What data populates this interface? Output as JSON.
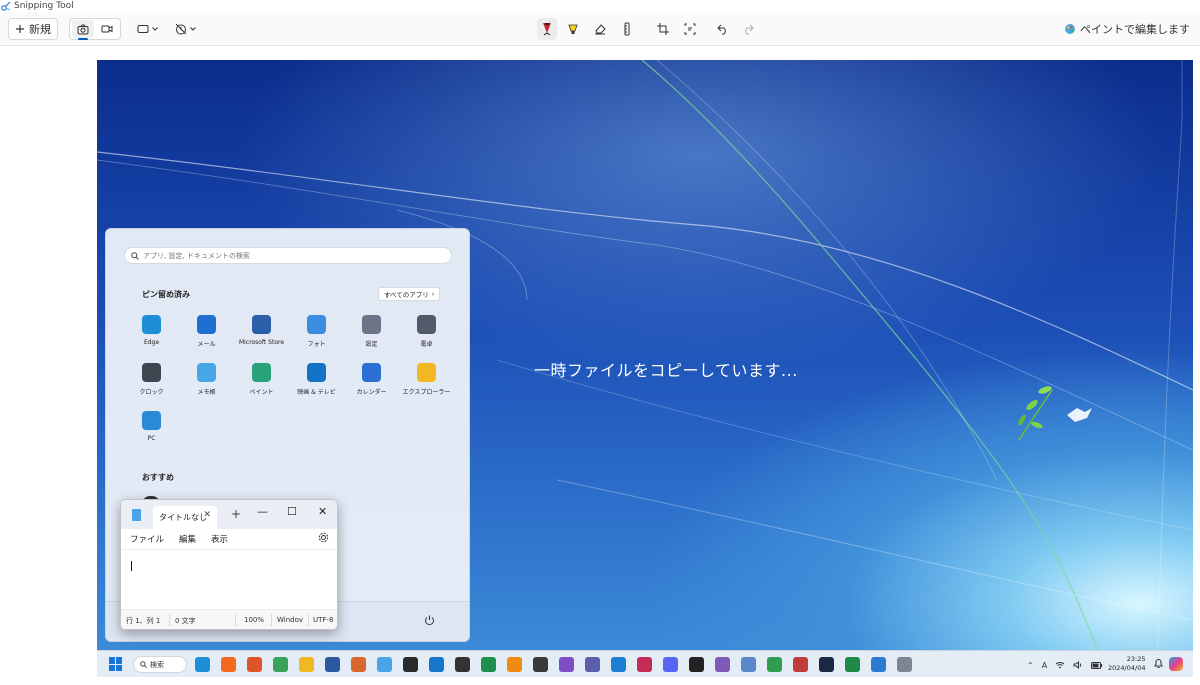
{
  "window": {
    "title": "Snipping Tool"
  },
  "toolbar": {
    "new_label": "新規",
    "paint_label": "ペイントで編集します"
  },
  "capture": {
    "message": "一時ファイルをコピーしています..."
  },
  "start_menu": {
    "search_placeholder": "アプリ, 設定, ドキュメントの検索",
    "pinned_title": "ピン留め済み",
    "all_apps_label": "すべてのアプリ",
    "apps": [
      {
        "label": "Edge",
        "icon": "edge-icon",
        "color": "#1d8fd6"
      },
      {
        "label": "メール",
        "icon": "mail-icon",
        "color": "#1f6fd0"
      },
      {
        "label": "Microsoft Store",
        "icon": "store-icon",
        "color": "#2b5fa8"
      },
      {
        "label": "フォト",
        "icon": "photos-icon",
        "color": "#3b8de0"
      },
      {
        "label": "設定",
        "icon": "settings-icon",
        "color": "#6b7587"
      },
      {
        "label": "電卓",
        "icon": "calculator-icon",
        "color": "#505a68"
      },
      {
        "label": "クロック",
        "icon": "clock-icon",
        "color": "#3f4650"
      },
      {
        "label": "メモ帳",
        "icon": "notepad-icon",
        "color": "#48a5e8"
      },
      {
        "label": "ペイント",
        "icon": "paint-icon",
        "color": "#2aa27c"
      },
      {
        "label": "映画 & テレビ",
        "icon": "movies-tv-icon",
        "color": "#1473c8"
      },
      {
        "label": "カレンダー",
        "icon": "calendar-icon",
        "color": "#2b6fd4"
      },
      {
        "label": "エクスプローラー",
        "icon": "file-explorer-icon",
        "color": "#f2b822"
      },
      {
        "label": "PC",
        "icon": "pc-icon",
        "color": "#2a8ad6"
      }
    ],
    "recommended_title": "おすすめ"
  },
  "notepad": {
    "tab_title": "タイトルなし",
    "menu": [
      "ファイル",
      "編集",
      "表示"
    ],
    "status": {
      "position": "行 1、列 1",
      "chars": "0 文字",
      "zoom": "100%",
      "line_ending": "Windov",
      "encoding": "UTF-8"
    }
  },
  "taskbar": {
    "search_label": "検索",
    "icons": [
      {
        "name": "edge-icon",
        "color": "#1d8fd6"
      },
      {
        "name": "firefox-icon",
        "color": "#f36a1d"
      },
      {
        "name": "firefox-dev-icon",
        "color": "#e0542a"
      },
      {
        "name": "leaf-icon",
        "color": "#3aa35a"
      },
      {
        "name": "file-explorer-icon",
        "color": "#f2b822"
      },
      {
        "name": "virtualbox-icon",
        "color": "#2c5aa0"
      },
      {
        "name": "brush-app-icon",
        "color": "#d7672c"
      },
      {
        "name": "notepad-icon",
        "color": "#48a5e8"
      },
      {
        "name": "terminal-icon",
        "color": "#2b2b2b"
      },
      {
        "name": "remote-desktop-icon",
        "color": "#1677c9"
      },
      {
        "name": "tools-icon",
        "color": "#333333"
      },
      {
        "name": "pen-app-icon",
        "color": "#1c8f4d"
      },
      {
        "name": "vlc-icon",
        "color": "#f08a12"
      },
      {
        "name": "obs-icon",
        "color": "#3a3a3a"
      },
      {
        "name": "visual-studio-icon",
        "color": "#7e4cc4"
      },
      {
        "name": "app-grid-icon",
        "color": "#5b5ea8"
      },
      {
        "name": "browser-app-icon",
        "color": "#1c7fd3"
      },
      {
        "name": "game-app-icon",
        "color": "#c42b55"
      },
      {
        "name": "discord-icon",
        "color": "#5865f2"
      },
      {
        "name": "unity-icon",
        "color": "#222222"
      },
      {
        "name": "emacs-icon",
        "color": "#7f5ab6"
      },
      {
        "name": "tool-app-icon",
        "color": "#5a88c8"
      },
      {
        "name": "chart-app-icon",
        "color": "#2f9c4f"
      },
      {
        "name": "media-app-icon",
        "color": "#c23b3b"
      },
      {
        "name": "steam-icon",
        "color": "#1b2a44"
      },
      {
        "name": "spreadsheet-icon",
        "color": "#1f8a48"
      },
      {
        "name": "snipping-tool-icon",
        "color": "#2a7bd1"
      },
      {
        "name": "installer-icon",
        "color": "#7c8591"
      }
    ],
    "time": "23:25",
    "date": "2024/04/04"
  },
  "colors": {
    "accent": "#005fb8",
    "desktop_dark": "#0b2d8c",
    "desktop_light": "#7fcaf2"
  }
}
